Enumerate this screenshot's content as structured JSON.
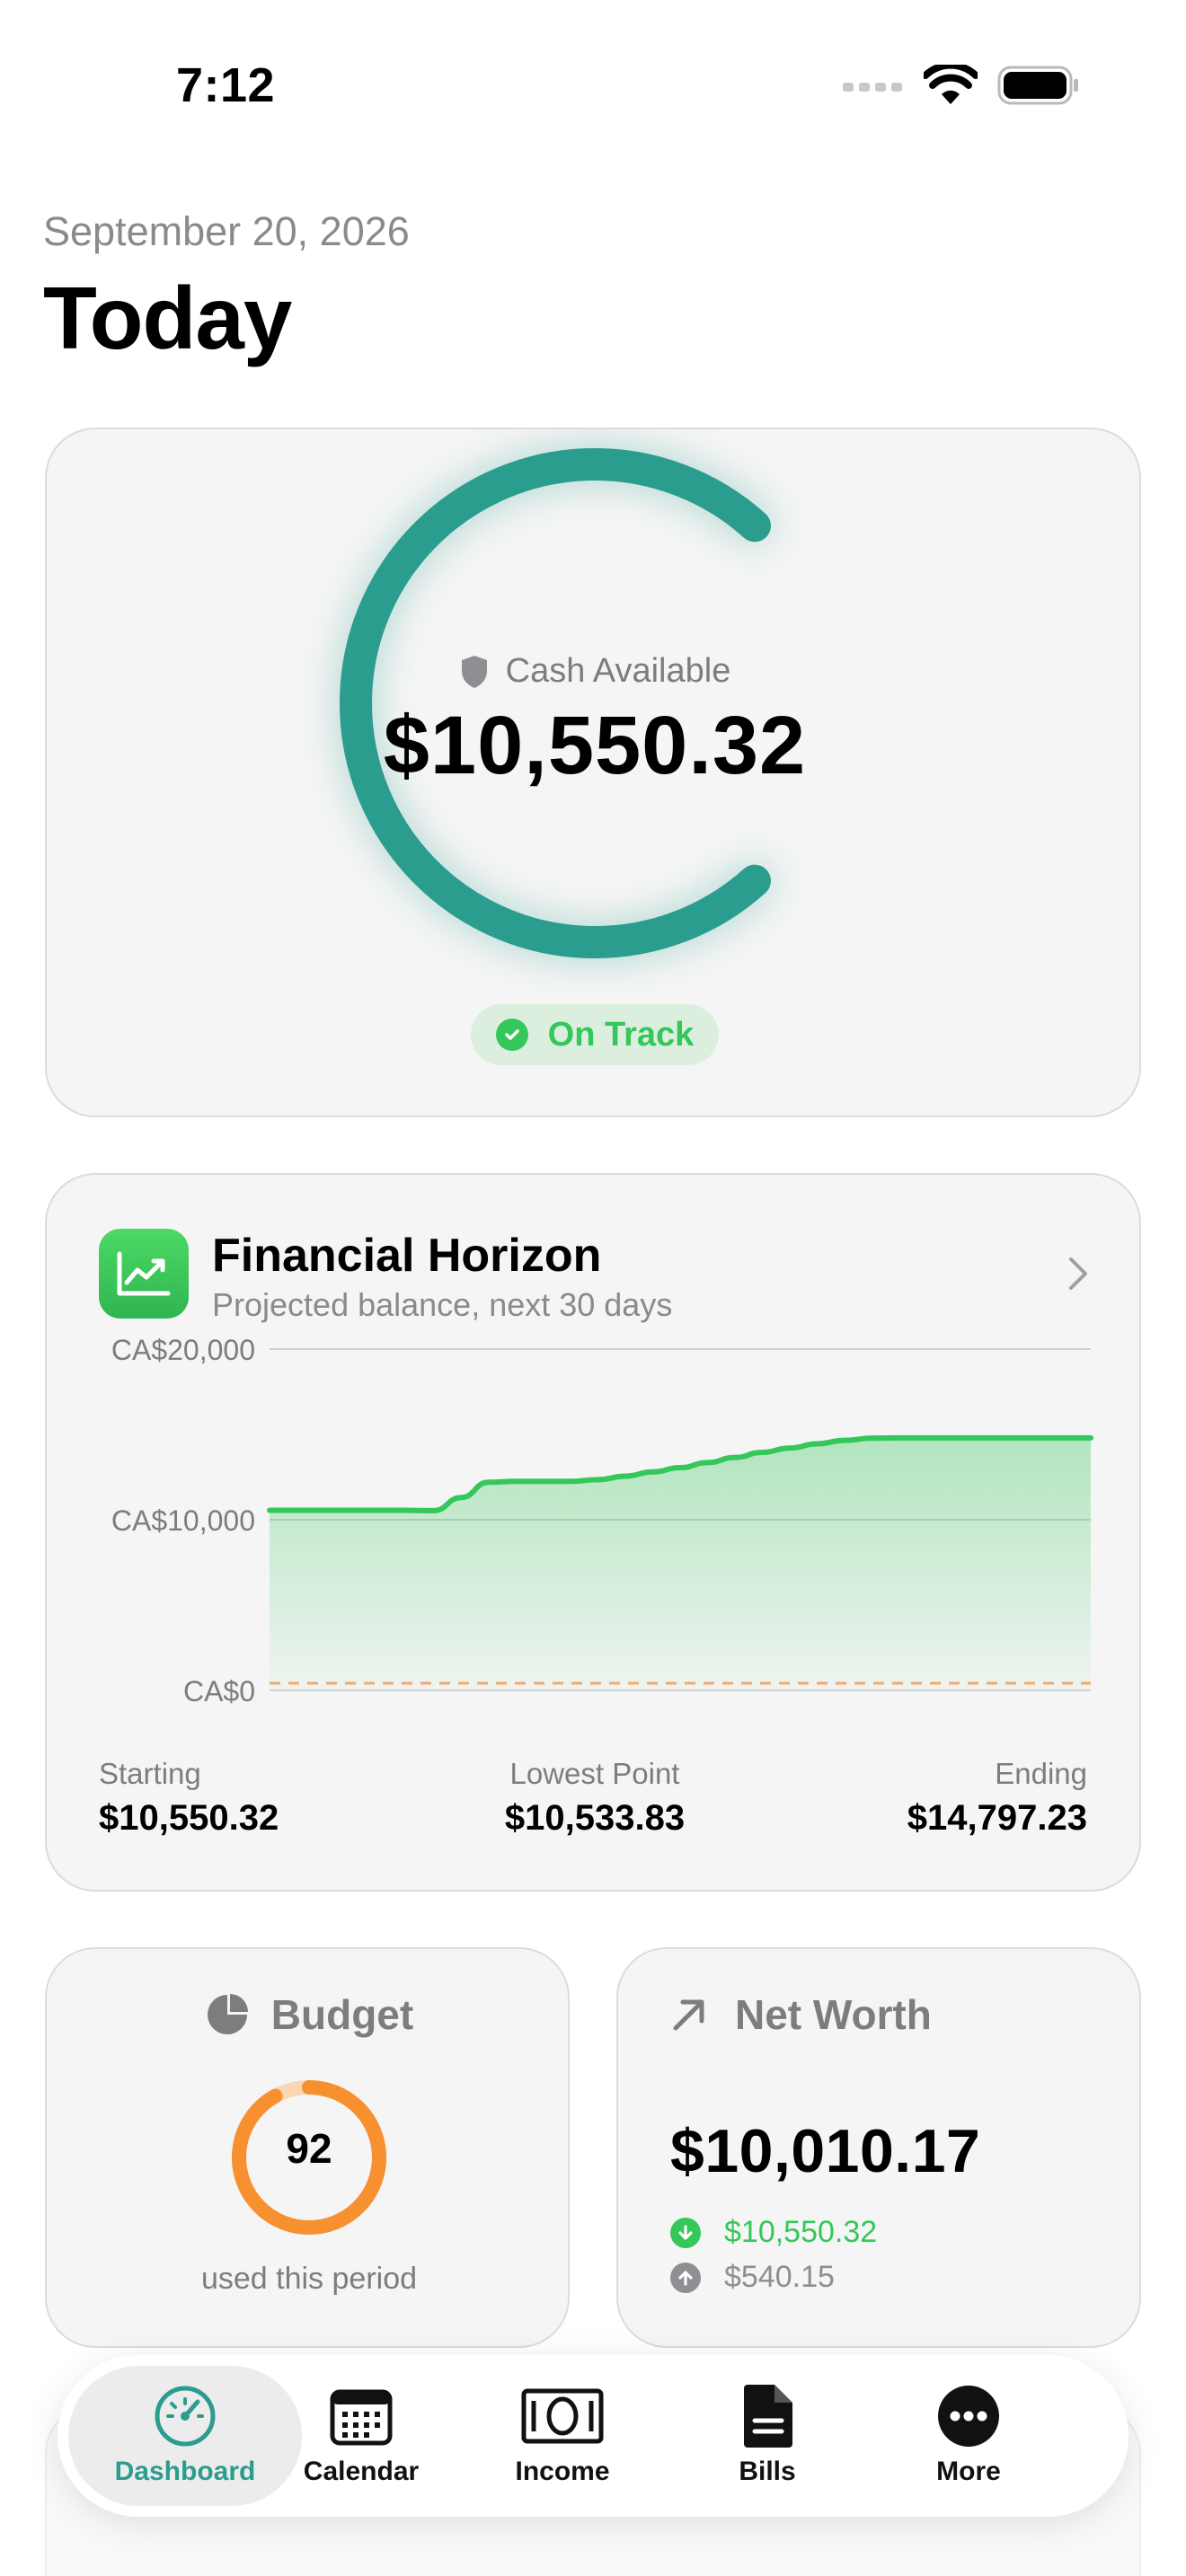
{
  "status_bar": {
    "time": "7:12"
  },
  "header": {
    "date": "September 20, 2026",
    "title": "Today"
  },
  "cash_card": {
    "label": "Cash Available",
    "amount": "$10,550.32",
    "status": "On Track",
    "accent": "#2a9d8f"
  },
  "horizon": {
    "title": "Financial Horizon",
    "subtitle": "Projected balance, next 30 days",
    "stats": {
      "starting_label": "Starting",
      "starting_value": "$10,550.32",
      "lowest_label": "Lowest Point",
      "lowest_value": "$10,533.83",
      "ending_label": "Ending",
      "ending_value": "$14,797.23"
    }
  },
  "chart_data": {
    "type": "area",
    "title": "Financial Horizon",
    "ylim": [
      0,
      20000
    ],
    "y_ticks": [
      "CA$20,000",
      "CA$10,000",
      "CA$0"
    ],
    "y_tick_values": [
      20000,
      10000,
      0
    ],
    "x": [
      0,
      1,
      2,
      3,
      4,
      5,
      6,
      7,
      8,
      9,
      10,
      11,
      12,
      13,
      14,
      15,
      16,
      17,
      18,
      19,
      20,
      21,
      22,
      23,
      24,
      25,
      26,
      27,
      28,
      29,
      30
    ],
    "series": [
      {
        "values": [
          10550,
          10550,
          10550,
          10550,
          10550,
          10550,
          10534,
          11300,
          12200,
          12250,
          12250,
          12250,
          12350,
          12550,
          12800,
          13050,
          13350,
          13650,
          13950,
          14200,
          14450,
          14650,
          14780,
          14797,
          14797,
          14797,
          14797,
          14797,
          14797,
          14797,
          14797
        ]
      }
    ],
    "threshold": 0,
    "grid": true,
    "line_color": "#34c759",
    "threshold_color": "#f5a96b"
  },
  "budget": {
    "title": "Budget",
    "value": "92",
    "caption": "used this period",
    "fraction": 0.92,
    "color": "#f7902e"
  },
  "net_worth": {
    "title": "Net Worth",
    "value": "$10,010.17",
    "assets": "$10,550.32",
    "liabilities": "$540.15",
    "assets_color": "#34c759",
    "liabilities_color": "#8e8e93"
  },
  "tab_bar": {
    "tabs": [
      {
        "label": "Dashboard",
        "icon": "speedometer-icon"
      },
      {
        "label": "Calendar",
        "icon": "calendar-icon"
      },
      {
        "label": "Income",
        "icon": "banknote-icon"
      },
      {
        "label": "Bills",
        "icon": "document-icon"
      },
      {
        "label": "More",
        "icon": "ellipsis-icon"
      }
    ],
    "active": "Dashboard"
  }
}
